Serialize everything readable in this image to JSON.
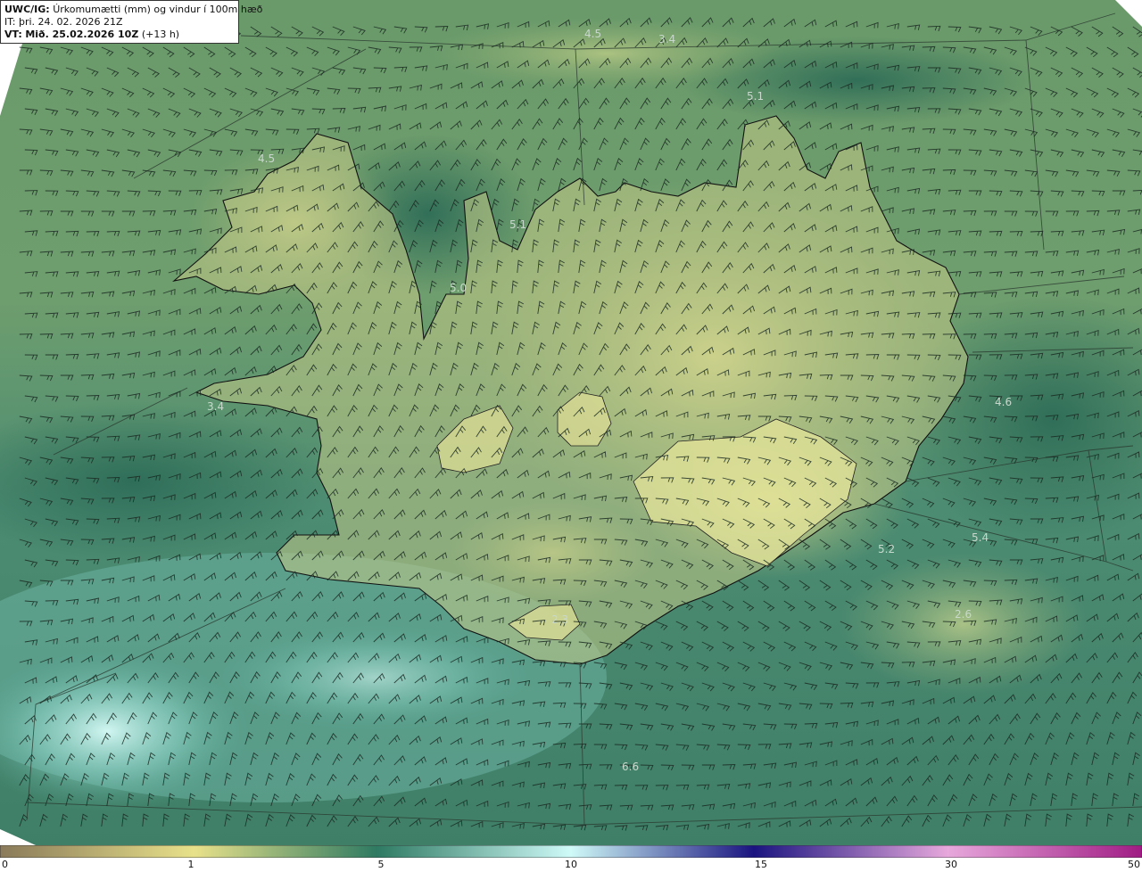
{
  "header": {
    "lead": "UWC/IG:",
    "title": "Úrkomumætti (mm) og vindur í 100m hæð",
    "it_label": "IT:",
    "it_value": "þri. 24. 02. 2026 21Z",
    "vt_label": "VT:",
    "vt_value": "Mið. 25.02.2026 10Z",
    "lead_time": "(+13 h)"
  },
  "map_labels": [
    {
      "text": "4.5"
    },
    {
      "text": "3.4"
    },
    {
      "text": "5.1"
    },
    {
      "text": "4.5"
    },
    {
      "text": "5.1"
    },
    {
      "text": "5.0"
    },
    {
      "text": "3.4"
    },
    {
      "text": "4.6"
    },
    {
      "text": "5.2"
    },
    {
      "text": "5.4"
    },
    {
      "text": "2.6"
    },
    {
      "text": "2.3"
    },
    {
      "text": "6.6"
    }
  ],
  "colorbar": {
    "min": 0,
    "max": 50,
    "ticks": [
      {
        "label": "0",
        "value": 0
      },
      {
        "label": "1",
        "value": 1
      },
      {
        "label": "5",
        "value": 5
      },
      {
        "label": "10",
        "value": 10
      },
      {
        "label": "15",
        "value": 15
      },
      {
        "label": "30",
        "value": 30
      },
      {
        "label": "50",
        "value": 50
      }
    ],
    "colors": {
      "c0": "#8a7a5a",
      "c1": "#e8e18a",
      "c5": "#2e7a62",
      "c10": "#cffaf8",
      "c15": "#1a1480",
      "c30": "#e7a8dc",
      "c50": "#a01c84"
    }
  },
  "colors": {
    "land_light": "#cfd48a",
    "sea_mid": "#4f8f72",
    "sea_dark": "#2f6f5a",
    "sea_teal": "#6fb5a5",
    "sea_cyan": "#bff0ee",
    "coast": "#111111"
  }
}
